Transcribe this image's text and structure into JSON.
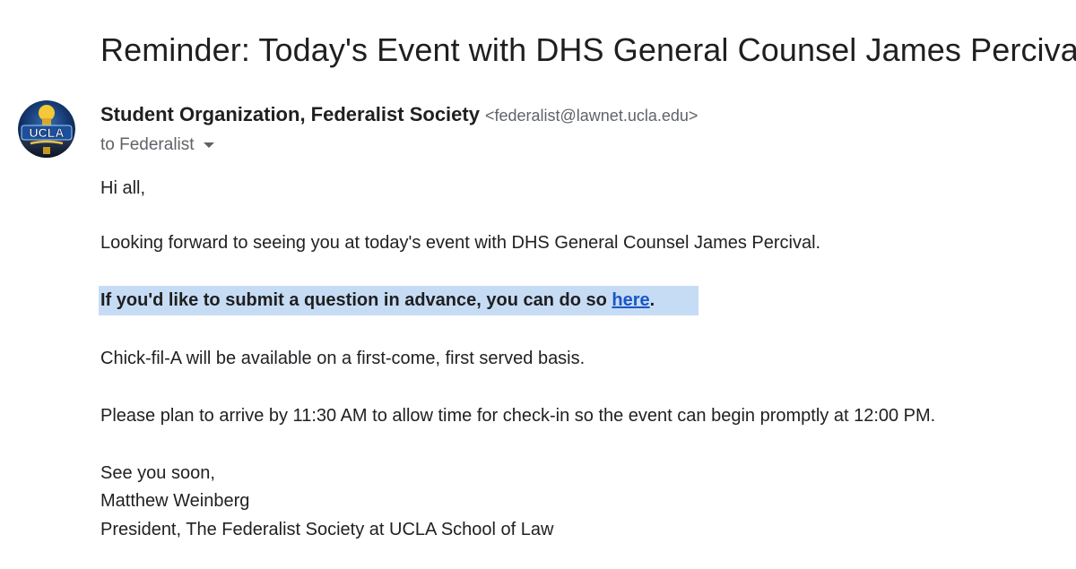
{
  "email": {
    "subject": "Reminder: Today's Event with DHS General Counsel James Percival",
    "sender": {
      "name": "Student Organization, Federalist Society",
      "email": "<federalist@lawnet.ucla.edu>",
      "avatar_text": "UCLA"
    },
    "recipient": {
      "label": "to Federalist"
    },
    "body": {
      "greeting": "Hi all,",
      "paragraph1": "Looking forward to seeing you at today's event with DHS General Counsel James Percival.",
      "question_prefix": "If you'd like to submit a question in advance, you can do so ",
      "question_link": "here",
      "question_suffix": ".",
      "paragraph3": "Chick-fil-A will be available on a first-come, first served basis.",
      "paragraph4": "Please plan to arrive by 11:30 AM to allow time for check-in so the event can begin promptly at 12:00 PM.",
      "closing": "See you soon,",
      "signer_name": "Matthew Weinberg",
      "signer_title": "President, The Federalist Society at UCLA School of Law"
    }
  },
  "colors": {
    "highlight": "#c6dcf5",
    "link": "#1a56c4",
    "secondary_text": "#5f6368"
  }
}
